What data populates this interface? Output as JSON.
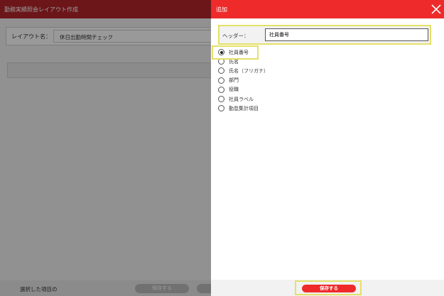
{
  "background": {
    "title": "勤務実績照会レイアウト作成",
    "layout_name_label": "レイアウト名：",
    "layout_name_value": "休日出勤時間チェック",
    "footer_label": "選択した項目の",
    "save_label": "保存する"
  },
  "panel": {
    "title": "追加",
    "header_label": "ヘッダー：",
    "header_value": "社員番号",
    "options": [
      {
        "label": "社員番号",
        "checked": true
      },
      {
        "label": "氏名",
        "checked": false
      },
      {
        "label": "氏名（フリガナ）",
        "checked": false
      },
      {
        "label": "部門",
        "checked": false
      },
      {
        "label": "役職",
        "checked": false
      },
      {
        "label": "社員ラベル",
        "checked": false
      },
      {
        "label": "勤怠集計項目",
        "checked": false
      }
    ],
    "save_label": "保存する"
  },
  "colors": {
    "panel_accent": "#ee2a2a",
    "background_header": "#b5262b",
    "highlight": "#e4e06a"
  },
  "icons": {
    "close": "close-icon"
  }
}
